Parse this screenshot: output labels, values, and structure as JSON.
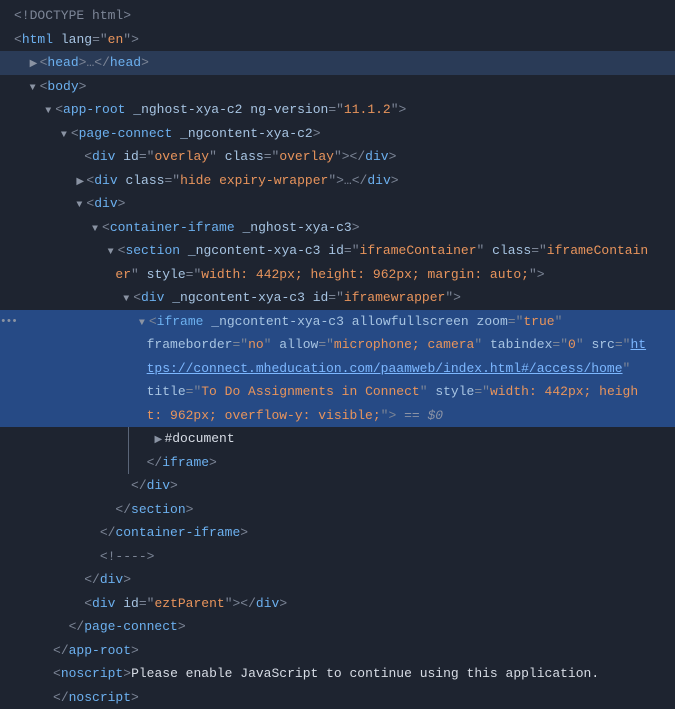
{
  "doctype": "<!DOCTYPE html>",
  "html_open": {
    "tag": "html",
    "attrs": [
      {
        "n": "lang",
        "v": "en"
      }
    ]
  },
  "head": {
    "open": "<head>",
    "ell": "…",
    "close": "</head>"
  },
  "body": {
    "tag": "body"
  },
  "app_root": {
    "tag": "app-root",
    "attrs": [
      {
        "n": "_nghost-xya-c2",
        "v": null
      },
      {
        "n": "ng-version",
        "v": "11.1.2"
      }
    ]
  },
  "page_connect": {
    "tag": "page-connect",
    "attrs": [
      {
        "n": "_ngcontent-xya-c2",
        "v": null
      }
    ]
  },
  "overlay_div": {
    "tag": "div",
    "attrs": [
      {
        "n": "id",
        "v": "overlay"
      },
      {
        "n": "class",
        "v": "overlay"
      }
    ]
  },
  "expiry_div": {
    "tag": "div",
    "attrs": [
      {
        "n": "class",
        "v": "hide expiry-wrapper"
      }
    ],
    "ell": "…"
  },
  "wrapper_div": {
    "tag": "div"
  },
  "container_iframe": {
    "tag": "container-iframe",
    "attrs": [
      {
        "n": "_nghost-xya-c3",
        "v": null
      }
    ]
  },
  "section": {
    "tag": "section",
    "line1_attrs": [
      {
        "n": "_ngcontent-xya-c3",
        "v": null
      },
      {
        "n": "id",
        "v": "iframeContainer"
      },
      {
        "n": "class",
        "v": "iframeContain"
      }
    ],
    "line2_prefix": "er",
    "line2_attrs": [
      {
        "n": "style",
        "v": "width: 442px; height: 962px; margin: auto;"
      }
    ]
  },
  "iframewrapper": {
    "tag": "div",
    "attrs": [
      {
        "n": "_ngcontent-xya-c3",
        "v": null
      },
      {
        "n": "id",
        "v": "iframewrapper"
      }
    ]
  },
  "iframe": {
    "tag": "iframe",
    "row1": [
      {
        "n": "_ngcontent-xya-c3",
        "v": null
      },
      {
        "n": "allowfullscreen",
        "v": null
      },
      {
        "n": "zoom",
        "v": "true"
      }
    ],
    "row2_a": [
      {
        "n": "frameborder",
        "v": "no"
      }
    ],
    "row2_allow": "microphone; camera",
    "row2_b": [
      {
        "n": "tabindex",
        "v": "0"
      }
    ],
    "src_prefix": "src",
    "url_part1": "ht",
    "url_part2": "tps://connect.mheducation.com/paamweb/index.html#/access/home",
    "row4_title": "To Do Assignments in Connect",
    "row4_style_a": "width: 442px; heigh",
    "row5_style_b": "t: 962px; overflow-y: visible;",
    "eq0": " == $0"
  },
  "document_child": "#document",
  "iframe_close": "iframe",
  "div_close": "div",
  "section_close": "section",
  "container_iframe_close": "container-iframe",
  "comment": "<!---->",
  "eztParent": {
    "tag": "div",
    "attrs": [
      {
        "n": "id",
        "v": "eztParent"
      }
    ]
  },
  "page_connect_close": "page-connect",
  "app_root_close": "app-root",
  "noscript": {
    "open": "noscript",
    "text": "Please enable JavaScript to continue using this application.",
    "close": "noscript"
  }
}
